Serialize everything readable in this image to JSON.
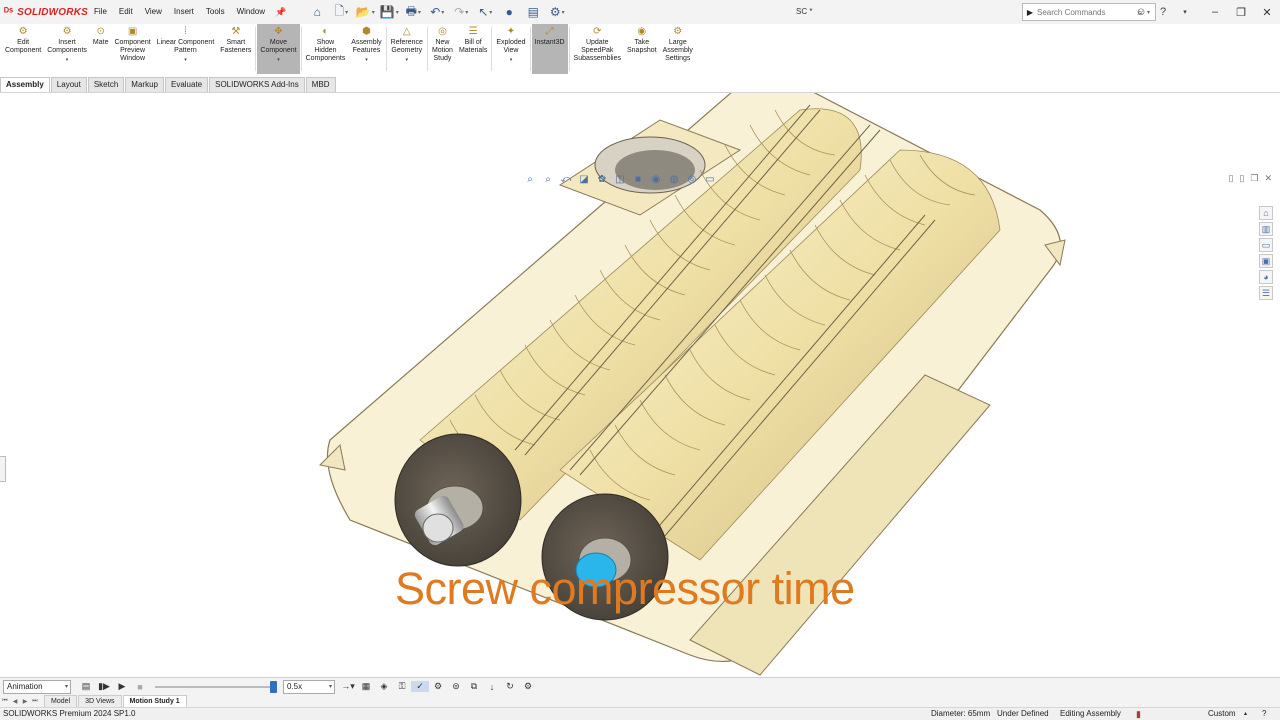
{
  "app": {
    "brand": "SOLIDWORKS",
    "document_title": "SC *"
  },
  "menu": [
    "File",
    "Edit",
    "View",
    "Insert",
    "Tools",
    "Window"
  ],
  "search": {
    "placeholder": "Search Commands"
  },
  "commands": [
    {
      "label": "Edit\nComponent",
      "icon": "edit-component-icon",
      "glyph": "⚙"
    },
    {
      "label": "Insert\nComponents",
      "icon": "insert-components-icon",
      "glyph": "⚙",
      "dropdown": true
    },
    {
      "label": "Mate",
      "icon": "mate-icon",
      "glyph": "⊙"
    },
    {
      "label": "Component\nPreview\nWindow",
      "icon": "preview-window-icon",
      "glyph": "▣"
    },
    {
      "label": "Linear Component\nPattern",
      "icon": "linear-pattern-icon",
      "glyph": "⁞",
      "dropdown": true
    },
    {
      "label": "Smart\nFasteners",
      "icon": "smart-fasteners-icon",
      "glyph": "⚒"
    },
    {
      "label": "Move\nComponent",
      "icon": "move-component-icon",
      "glyph": "✥",
      "dropdown": true,
      "active": true
    },
    {
      "label": "Show\nHidden\nComponents",
      "icon": "show-hidden-icon",
      "glyph": "◐"
    },
    {
      "label": "Assembly\nFeatures",
      "icon": "assembly-features-icon",
      "glyph": "⬢",
      "dropdown": true
    },
    {
      "label": "Reference\nGeometry",
      "icon": "reference-geometry-icon",
      "glyph": "△",
      "dropdown": true
    },
    {
      "label": "New\nMotion\nStudy",
      "icon": "motion-study-icon",
      "glyph": "◎"
    },
    {
      "label": "Bill of\nMaterials",
      "icon": "bom-icon",
      "glyph": "☰"
    },
    {
      "label": "Exploded\nView",
      "icon": "exploded-view-icon",
      "glyph": "✦",
      "dropdown": true
    },
    {
      "label": "Instant3D",
      "icon": "instant3d-icon",
      "glyph": "⤢",
      "active": true
    },
    {
      "label": "Update\nSpeedPak\nSubassemblies",
      "icon": "speedpak-icon",
      "glyph": "⟳"
    },
    {
      "label": "Take\nSnapshot",
      "icon": "snapshot-icon",
      "glyph": "◉"
    },
    {
      "label": "Large\nAssembly\nSettings",
      "icon": "large-assembly-icon",
      "glyph": "⚙"
    }
  ],
  "tabs": [
    "Assembly",
    "Layout",
    "Sketch",
    "Markup",
    "Evaluate",
    "SOLIDWORKS Add-Ins",
    "MBD"
  ],
  "active_tab": "Assembly",
  "overlay_caption": "Screw compressor time",
  "motion": {
    "study_type": "Animation",
    "speed": "0.5x",
    "slider_fraction": 1.0
  },
  "bottom_tabs": [
    "Model",
    "3D Views",
    "Motion Study 1"
  ],
  "active_bottom_tab": "Motion Study 1",
  "status": {
    "version": "SOLIDWORKS Premium 2024 SP1.0",
    "diameter": "Diameter: 65mm",
    "definition": "Under Defined",
    "mode": "Editing Assembly",
    "units": "Custom"
  },
  "colors": {
    "accent": "#2f6fc4",
    "brand": "#dd2222",
    "caption": "#e07a20",
    "housing": "#efe0a6",
    "rotor": "#f3e6b4",
    "selected_face": "#2ab6ea"
  }
}
